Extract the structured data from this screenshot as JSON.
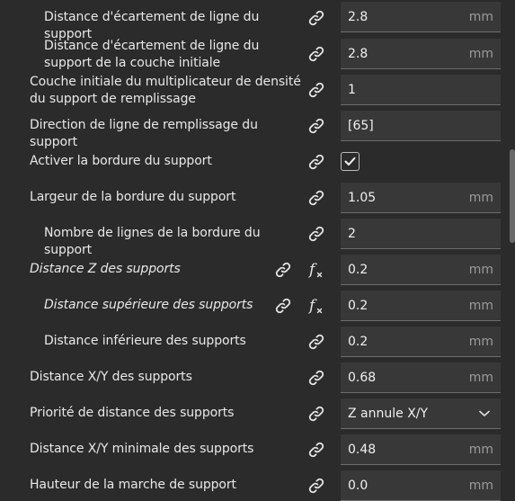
{
  "settings": [
    {
      "label": "Distance d'écartement de ligne du support",
      "value": "2.8",
      "unit": "mm"
    },
    {
      "label": "Distance d'écartement de ligne du support de la couche initiale",
      "value": "2.8",
      "unit": "mm"
    },
    {
      "label": "Couche initiale du multiplicateur de densité du support de remplissage",
      "value": "1",
      "unit": ""
    },
    {
      "label": "Direction de ligne de remplissage du support",
      "value": "[65]",
      "unit": ""
    },
    {
      "label": "Activer la bordure du support",
      "checked": true
    },
    {
      "label": "Largeur de la bordure du support",
      "value": "1.05",
      "unit": "mm"
    },
    {
      "label": "Nombre de lignes de la bordure du support",
      "value": "2",
      "unit": ""
    },
    {
      "label": "Distance Z des supports",
      "value": "0.2",
      "unit": "mm"
    },
    {
      "label": "Distance supérieure des supports",
      "value": "0.2",
      "unit": "mm"
    },
    {
      "label": "Distance inférieure des supports",
      "value": "0.2",
      "unit": "mm"
    },
    {
      "label": "Distance X/Y des supports",
      "value": "0.68",
      "unit": "mm"
    },
    {
      "label": "Priorité de distance des supports",
      "value": "Z annule X/Y",
      "unit": ""
    },
    {
      "label": "Distance X/Y minimale des supports",
      "value": "0.48",
      "unit": "mm"
    },
    {
      "label": "Hauteur de la marche de support",
      "value": "0.0",
      "unit": "mm"
    }
  ],
  "icons": {
    "link": "link-icon",
    "function": "function-icon",
    "check": "check-icon",
    "chevron": "chevron-down-icon"
  }
}
